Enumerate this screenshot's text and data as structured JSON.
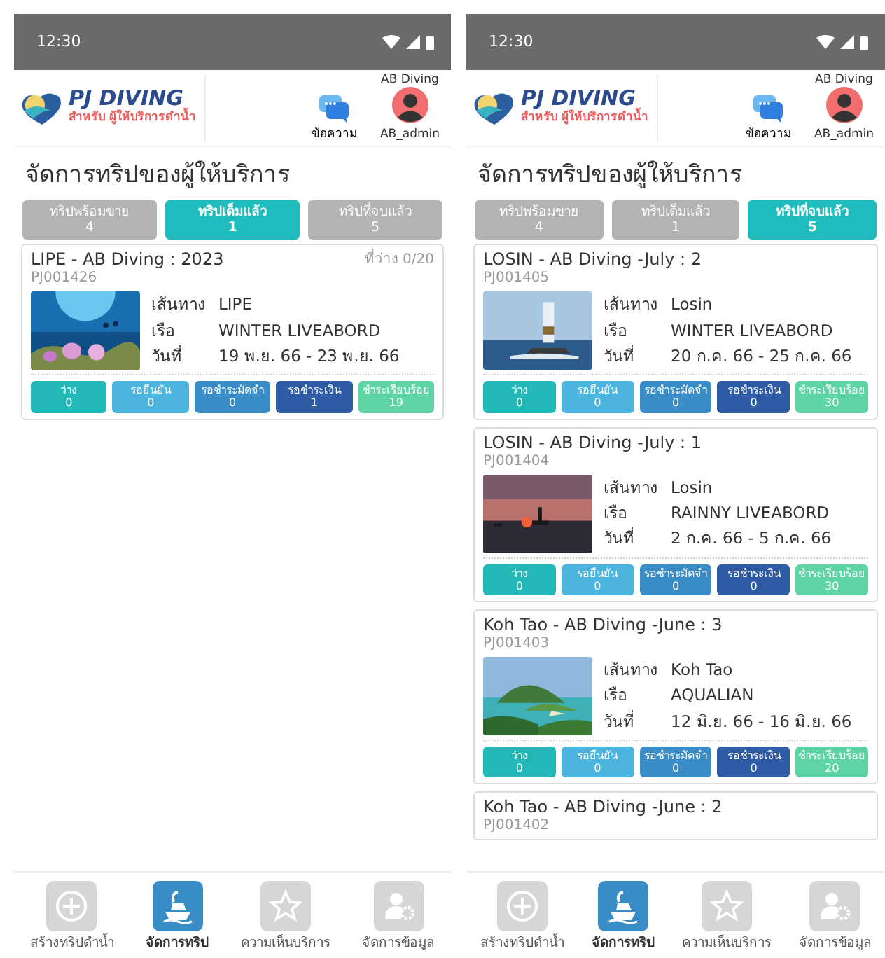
{
  "screens": [
    {
      "status_time": "12:30",
      "brand": {
        "name": "PJ DIVING",
        "tagline": "สำหรับ ผู้ให้บริการดำน้ำ"
      },
      "messages_label": "ข้อความ",
      "account": {
        "company": "AB Diving",
        "user": "AB_admin"
      },
      "title": "จัดการทริปของผู้ให้บริการ",
      "tabs": [
        {
          "label": "ทริปพร้อมขาย",
          "count": "4",
          "selected": false
        },
        {
          "label": "ทริปเต็มแล้ว",
          "count": "1",
          "selected": true
        },
        {
          "label": "ทริปที่จบแล้ว",
          "count": "5",
          "selected": false
        }
      ],
      "trips": [
        {
          "title": "LIPE - AB Diving : 2023",
          "seats": "ที่ว่าง 0/20",
          "code": "PJ001426",
          "photo": {
            "kind": "picture"
          },
          "details": [
            {
              "label": "เส้นทาง",
              "value": "LIPE"
            },
            {
              "label": "เรือ",
              "value": "WINTER LIVEABORD"
            },
            {
              "label": "วันที่",
              "value": "19 พ.ย. 66 - 23 พ.ย. 66"
            }
          ],
          "statuses": [
            {
              "label": "ว่าง",
              "count": "0",
              "color": "#22b8b8"
            },
            {
              "label": "รอยืนยัน",
              "count": "0",
              "color": "#4bb4df"
            },
            {
              "label": "รอชำระมัดจำ",
              "count": "0",
              "color": "#3a8cc6"
            },
            {
              "label": "รอชำระเงิน",
              "count": "1",
              "color": "#2f5ba5"
            },
            {
              "label": "ชำระเรียบร้อย",
              "count": "19",
              "color": "#5ed4a5"
            }
          ]
        }
      ],
      "nav": [
        {
          "label": "สร้างทริปดำน้ำ",
          "selected": false
        },
        {
          "label": "จัดการทริป",
          "selected": true
        },
        {
          "label": "ความเห็นบริการ",
          "selected": false
        },
        {
          "label": "จัดการข้อมูล",
          "selected": false
        }
      ]
    },
    {
      "status_time": "12:30",
      "brand": {
        "name": "PJ DIVING",
        "tagline": "สำหรับ ผู้ให้บริการดำน้ำ"
      },
      "messages_label": "ข้อความ",
      "account": {
        "company": "AB Diving",
        "user": "AB_admin"
      },
      "title": "จัดการทริปของผู้ให้บริการ",
      "tabs": [
        {
          "label": "ทริปพร้อมขาย",
          "count": "4",
          "selected": false
        },
        {
          "label": "ทริปเต็มแล้ว",
          "count": "1",
          "selected": false
        },
        {
          "label": "ทริปที่จบแล้ว",
          "count": "5",
          "selected": true
        }
      ],
      "trips": [
        {
          "title": "LOSIN - AB Diving -July : 2",
          "code": "PJ001405",
          "photo": {
            "kind": "picture"
          },
          "details": [
            {
              "label": "เส้นทาง",
              "value": "Losin"
            },
            {
              "label": "เรือ",
              "value": "WINTER LIVEABORD"
            },
            {
              "label": "วันที่",
              "value": "20 ก.ค. 66 - 25 ก.ค. 66"
            }
          ],
          "statuses": [
            {
              "label": "ว่าง",
              "count": "0",
              "color": "#22b8b8"
            },
            {
              "label": "รอยืนยัน",
              "count": "0",
              "color": "#4bb4df"
            },
            {
              "label": "รอชำระมัดจำ",
              "count": "0",
              "color": "#3a8cc6"
            },
            {
              "label": "รอชำระเงิน",
              "count": "0",
              "color": "#2f5ba5"
            },
            {
              "label": "ชำระเรียบร้อย",
              "count": "30",
              "color": "#5ed4a5"
            }
          ]
        },
        {
          "title": "LOSIN - AB Diving -July : 1",
          "code": "PJ001404",
          "photo": {
            "kind": "picture"
          },
          "details": [
            {
              "label": "เส้นทาง",
              "value": "Losin"
            },
            {
              "label": "เรือ",
              "value": "RAINNY LIVEABORD"
            },
            {
              "label": "วันที่",
              "value": "2 ก.ค. 66 - 5 ก.ค. 66"
            }
          ],
          "statuses": [
            {
              "label": "ว่าง",
              "count": "0",
              "color": "#22b8b8"
            },
            {
              "label": "รอยืนยัน",
              "count": "0",
              "color": "#4bb4df"
            },
            {
              "label": "รอชำระมัดจำ",
              "count": "0",
              "color": "#3a8cc6"
            },
            {
              "label": "รอชำระเงิน",
              "count": "0",
              "color": "#2f5ba5"
            },
            {
              "label": "ชำระเรียบร้อย",
              "count": "30",
              "color": "#5ed4a5"
            }
          ]
        },
        {
          "title": "Koh Tao - AB Diving -June : 3",
          "code": "PJ001403",
          "photo": {
            "kind": "picture"
          },
          "details": [
            {
              "label": "เส้นทาง",
              "value": "Koh Tao"
            },
            {
              "label": "เรือ",
              "value": "AQUALIAN"
            },
            {
              "label": "วันที่",
              "value": "12 มิ.ย. 66 - 16 มิ.ย. 66"
            }
          ],
          "statuses": [
            {
              "label": "ว่าง",
              "count": "0",
              "color": "#22b8b8"
            },
            {
              "label": "รอยืนยัน",
              "count": "0",
              "color": "#4bb4df"
            },
            {
              "label": "รอชำระมัดจำ",
              "count": "0",
              "color": "#3a8cc6"
            },
            {
              "label": "รอชำระเงิน",
              "count": "0",
              "color": "#2f5ba5"
            },
            {
              "label": "ชำระเรียบร้อย",
              "count": "20",
              "color": "#5ed4a5"
            }
          ]
        },
        {
          "title": "Koh Tao - AB Diving -June : 2",
          "code": "PJ001402"
        }
      ],
      "nav": [
        {
          "label": "สร้างทริปดำน้ำ",
          "selected": false
        },
        {
          "label": "จัดการทริป",
          "selected": true
        },
        {
          "label": "ความเห็นบริการ",
          "selected": false
        },
        {
          "label": "จัดการข้อมูล",
          "selected": false
        }
      ]
    }
  ]
}
